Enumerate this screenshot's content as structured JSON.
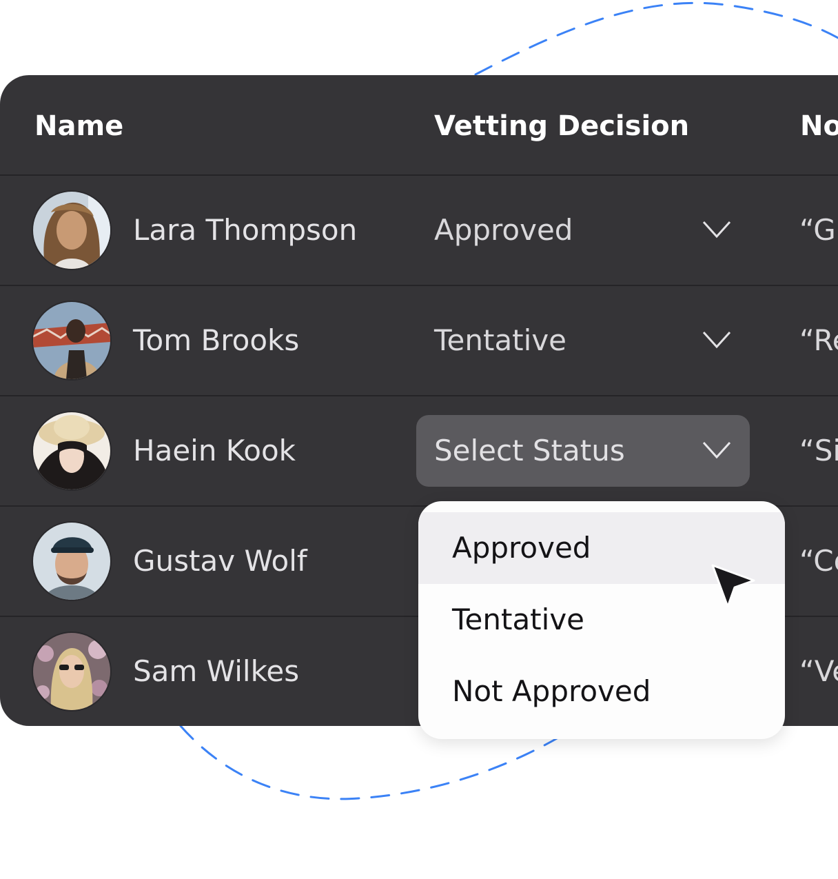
{
  "table": {
    "headers": {
      "name": "Name",
      "vetting": "Vetting Decision",
      "notes": "No"
    },
    "rows": [
      {
        "name": "Lara Thompson",
        "status": "Approved",
        "note": "“G"
      },
      {
        "name": "Tom Brooks",
        "status": "Tentative",
        "note": "“Re"
      },
      {
        "name": "Haein Kook",
        "status": "Select Status",
        "note": "“Si"
      },
      {
        "name": "Gustav Wolf",
        "status": "",
        "note": "“Co"
      },
      {
        "name": "Sam Wilkes",
        "status": "",
        "note": "“Ve"
      }
    ]
  },
  "dropdown": {
    "options": [
      "Approved",
      "Tentative",
      "Not Approved"
    ],
    "hovered_option": "Approved"
  },
  "colors": {
    "panel_bg": "#353437",
    "select_bg": "#5b5a5e",
    "dropdown_bg": "#fdfdfd",
    "dropdown_hover": "#efeef1",
    "dashed_line": "#3b82f6"
  },
  "icons": {
    "dropdown_arrow": "chevron-down-icon",
    "pointer": "cursor-arrow-icon"
  }
}
